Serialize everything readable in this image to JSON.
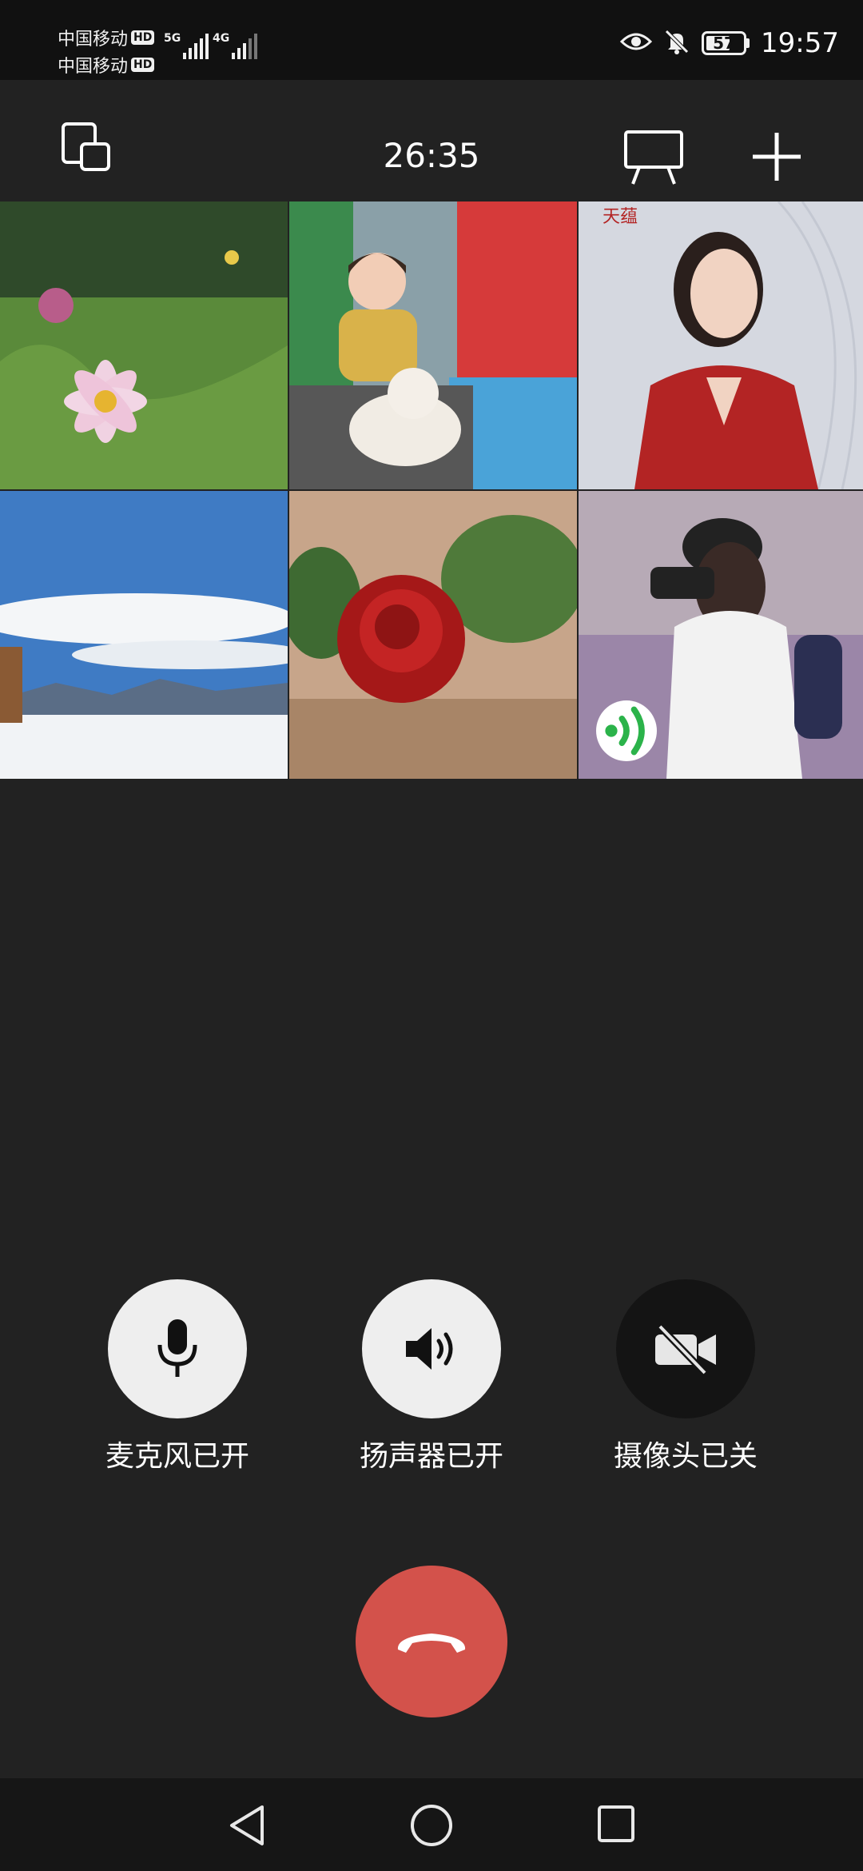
{
  "status_bar": {
    "carrier_1": "中国移动",
    "carrier_2": "中国移动",
    "hd": "HD",
    "net_1": "5G",
    "net_2": "4G",
    "battery_level": "57",
    "time": "19:57",
    "icons": [
      "eye-icon",
      "bell-off-icon",
      "battery-icon"
    ]
  },
  "top_bar": {
    "call_duration": "26:35",
    "icons": [
      "minimize-window-icon",
      "screen-share-icon",
      "add-participant-icon"
    ]
  },
  "participants": [
    {
      "tile": "participant-1",
      "image": "pink cosmos flower"
    },
    {
      "tile": "participant-2",
      "image": "child with teddy bear on playground"
    },
    {
      "tile": "participant-3",
      "image": "woman in red blazer",
      "watermark": "天蕴"
    },
    {
      "tile": "participant-4",
      "image": "snowy mountain landscape"
    },
    {
      "tile": "participant-5",
      "image": "red rose"
    },
    {
      "tile": "participant-6",
      "image": "woman with camera",
      "speaking": true
    }
  ],
  "controls": {
    "microphone_label": "麦克风已开",
    "speaker_label": "扬声器已开",
    "camera_label": "摄像头已关"
  },
  "colors": {
    "background": "#222222",
    "hangup": "#d3524b",
    "speaking": "#2bb34a"
  }
}
